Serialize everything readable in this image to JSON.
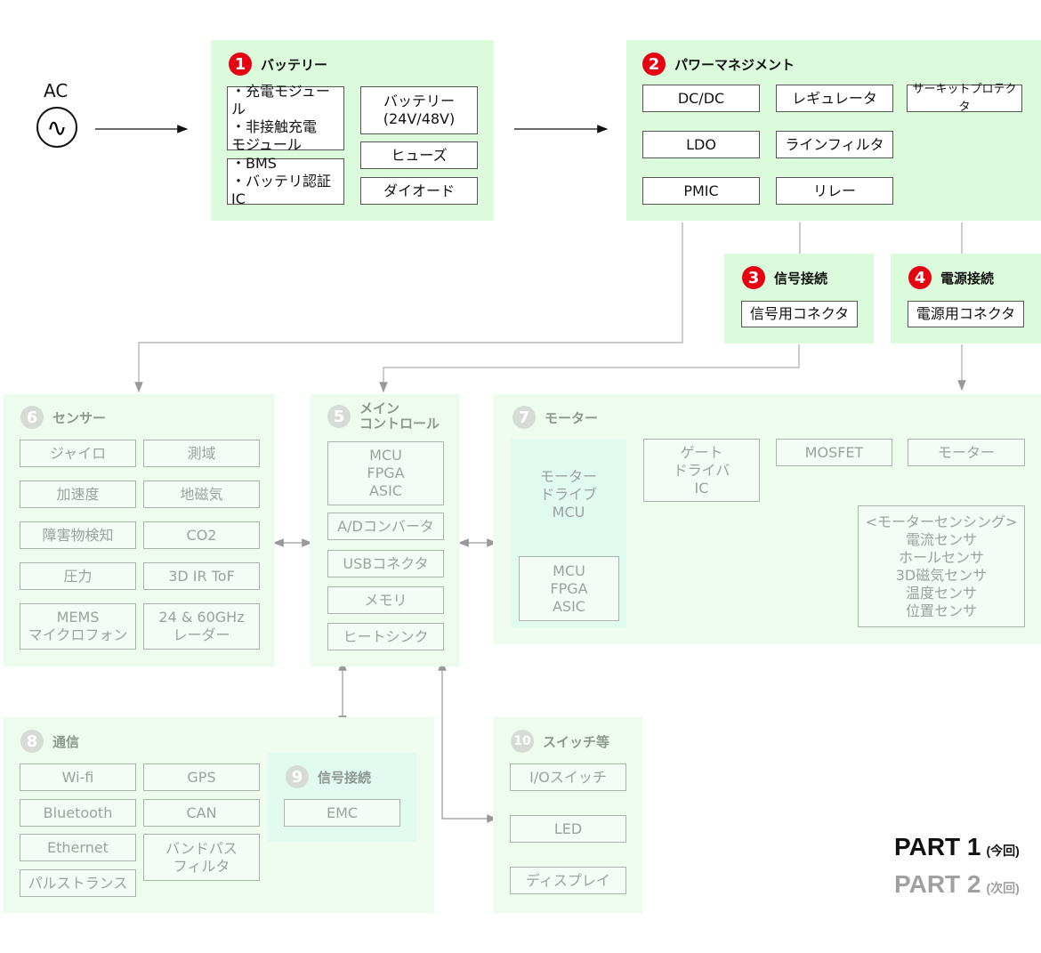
{
  "ac": {
    "label": "AC",
    "icon": "ac-sine-icon"
  },
  "battery": {
    "num": "1",
    "title": "バッテリー",
    "items": [
      "・充電モジュール\n・非接触充電\n モジュール",
      "・BMS\n・バッテリ認証IC",
      "バッテリー\n(24V/48V)",
      "ヒューズ",
      "ダイオード"
    ]
  },
  "power": {
    "num": "2",
    "title": "パワーマネジメント",
    "items": [
      "DC/DC",
      "レギュレータ",
      "サーキットプロテクタ",
      "LDO",
      "ラインフィルタ",
      "PMIC",
      "リレー"
    ]
  },
  "signal_conn": {
    "num": "3",
    "title": "信号接続",
    "items": [
      "信号用コネクタ"
    ]
  },
  "power_conn": {
    "num": "4",
    "title": "電源接続",
    "items": [
      "電源用コネクタ"
    ]
  },
  "main_control": {
    "num": "5",
    "title": "メイン\nコントロール",
    "items": [
      "MCU\nFPGA\nASIC",
      "A/Dコンバータ",
      "USBコネクタ",
      "メモリ",
      "ヒートシンク"
    ]
  },
  "sensor": {
    "num": "6",
    "title": "センサー",
    "items": [
      "ジャイロ",
      "測域",
      "加速度",
      "地磁気",
      "障害物検知",
      "CO2",
      "圧力",
      "3D IR ToF",
      "MEMS\nマイクロフォン",
      "24 & 60GHz\nレーダー"
    ]
  },
  "motor": {
    "num": "7",
    "title": "モーター",
    "drive_label": "モーター\nドライブ\nMCU",
    "items": [
      "MCU\nFPGA\nASIC",
      "ゲート\nドライバ\nIC",
      "MOSFET",
      "モーター",
      "<モーターセンシング>\n電流センサ\nホールセンサ\n3D磁気センサ\n温度センサ\n位置センサ"
    ]
  },
  "comm": {
    "num": "8",
    "title": "通信",
    "items": [
      "Wi-fi",
      "GPS",
      "Bluetooth",
      "CAN",
      "Ethernet",
      "バンドパス\nフィルタ",
      "パルストランス"
    ]
  },
  "signal_conn2": {
    "num": "9",
    "title": "信号接続",
    "items": [
      "EMC"
    ]
  },
  "switches": {
    "num": "10",
    "title": "スイッチ等",
    "items": [
      "I/Oスイッチ",
      "LED",
      "ディスプレイ"
    ]
  },
  "legend": {
    "part1": "PART 1",
    "part1_note": "(今回)",
    "part2": "PART 2",
    "part2_note": "(次回)"
  },
  "colors": {
    "active_panel": "#dcfadc",
    "faded_panel": "#eefcf0",
    "badge_red": "#e60012",
    "badge_gray": "#d6dbd6"
  }
}
